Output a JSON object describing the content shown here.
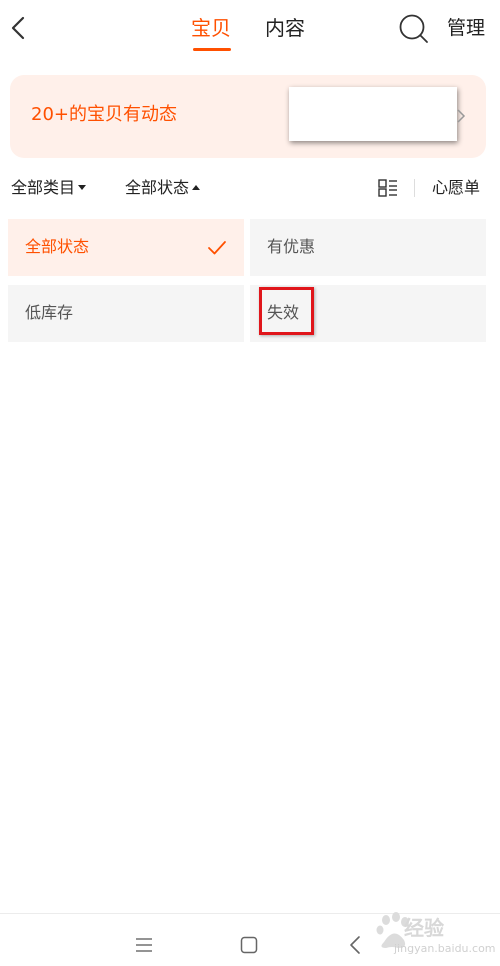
{
  "header": {
    "tabs": [
      {
        "label": "宝贝",
        "active": true
      },
      {
        "label": "内容",
        "active": false
      }
    ],
    "manage_label": "管理"
  },
  "banner": {
    "text": "20+的宝贝有动态"
  },
  "filter_bar": {
    "category_label": "全部类目",
    "status_label": "全部状态",
    "wishlist_label": "心愿单"
  },
  "status_options": [
    {
      "label": "全部状态",
      "selected": true
    },
    {
      "label": "有优惠",
      "selected": false
    },
    {
      "label": "低库存",
      "selected": false
    },
    {
      "label": "失效",
      "selected": false,
      "highlighted": true
    }
  ],
  "watermark": {
    "text": "经验",
    "sub": "jingyan.baidu.com"
  },
  "colors": {
    "accent": "#ff5000",
    "banner_bg": "#fff0ea",
    "option_bg": "#f5f5f5",
    "highlight": "#e0161b"
  },
  "icons": [
    "back-arrow-icon",
    "search-icon",
    "chevron-right-icon",
    "grid-list-icon",
    "checkmark-icon",
    "menu-lines-icon",
    "home-square-icon",
    "back-chevron-icon"
  ]
}
